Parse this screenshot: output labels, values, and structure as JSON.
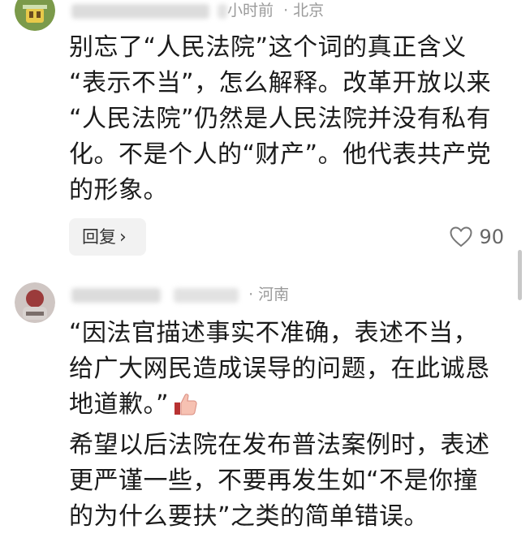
{
  "comments": [
    {
      "username": "用户昵称",
      "time_text": "小时前",
      "location": "北京",
      "body_lines": [
        "别忘了“人民法院”这个词的真正含义",
        "“表示不当”，怎么解释。改革开放以来",
        "“人民法院”仍然是人民法院并没有私有",
        "化。不是个人的“财产”。他代表共产党",
        "的形象。"
      ],
      "reply_label": "回复",
      "like_count": "90"
    },
    {
      "username": "用户昵称",
      "time_text": "",
      "location": "河南",
      "body_lines": [
        "“因法官描述事实不准确，表述不当，",
        "给广大网民造成误导的问题，在此诚恳",
        "地道歉。”",
        "希望以后法院在发布普法案例时，表述",
        "更严谨一些，不要再发生如“不是你撞",
        "的为什么要扶”之类的简单错误。"
      ],
      "emoji": "thumbs-up-icon"
    }
  ],
  "ui": {
    "separator": "·",
    "reply_chevron": "›"
  }
}
